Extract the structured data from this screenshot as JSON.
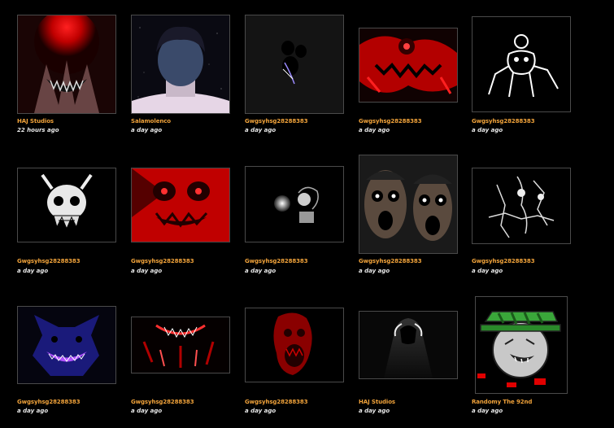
{
  "gallery": {
    "items": [
      {
        "author": "HAJ Studios",
        "time": "22 hours ago"
      },
      {
        "author": "Salamolenco",
        "time": "a day ago"
      },
      {
        "author": "Gwgsyhsg28288383",
        "time": "a day ago"
      },
      {
        "author": "Gwgsyhsg28288383",
        "time": "a day ago"
      },
      {
        "author": "Gwgsyhsg28288383",
        "time": "a day ago"
      },
      {
        "author": "Gwgsyhsg28288383",
        "time": "a day ago"
      },
      {
        "author": "Gwgsyhsg28288383",
        "time": "a day ago"
      },
      {
        "author": "Gwgsyhsg28288383",
        "time": "a day ago"
      },
      {
        "author": "Gwgsyhsg28288383",
        "time": "a day ago"
      },
      {
        "author": "Gwgsyhsg28288383",
        "time": "a day ago"
      },
      {
        "author": "Gwgsyhsg28288383",
        "time": "a day ago"
      },
      {
        "author": "Gwgsyhsg28288383",
        "time": "a day ago"
      },
      {
        "author": "Gwgsyhsg28288383",
        "time": "a day ago"
      },
      {
        "author": "HAJ Studios",
        "time": "a day ago"
      },
      {
        "author": "Randomy The 92nd",
        "time": "a day ago"
      }
    ]
  },
  "colors": {
    "author": "#f0a23a",
    "time": "#e8e8e8",
    "background": "#000000"
  }
}
